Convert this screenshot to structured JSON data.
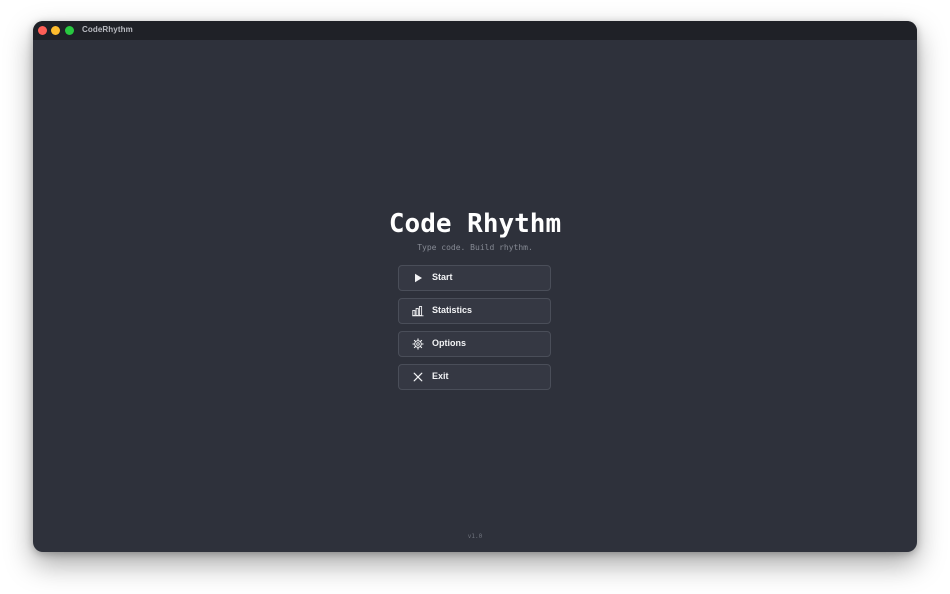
{
  "window": {
    "title": "CodeRhythm",
    "traffic_lights": {
      "close_color": "#fe5f57",
      "minimize_color": "#febc2e",
      "maximize_color": "#28c840"
    },
    "background_color": "#2e313b",
    "titlebar_color": "#1f2127"
  },
  "main": {
    "title": "Code Rhythm",
    "tagline": "Type code. Build rhythm.",
    "menu": [
      {
        "label": "Start",
        "icon": "play-icon"
      },
      {
        "label": "Statistics",
        "icon": "bar-chart-icon"
      },
      {
        "label": "Options",
        "icon": "gear-icon"
      },
      {
        "label": "Exit",
        "icon": "close-icon"
      }
    ],
    "version": "v1.0"
  }
}
